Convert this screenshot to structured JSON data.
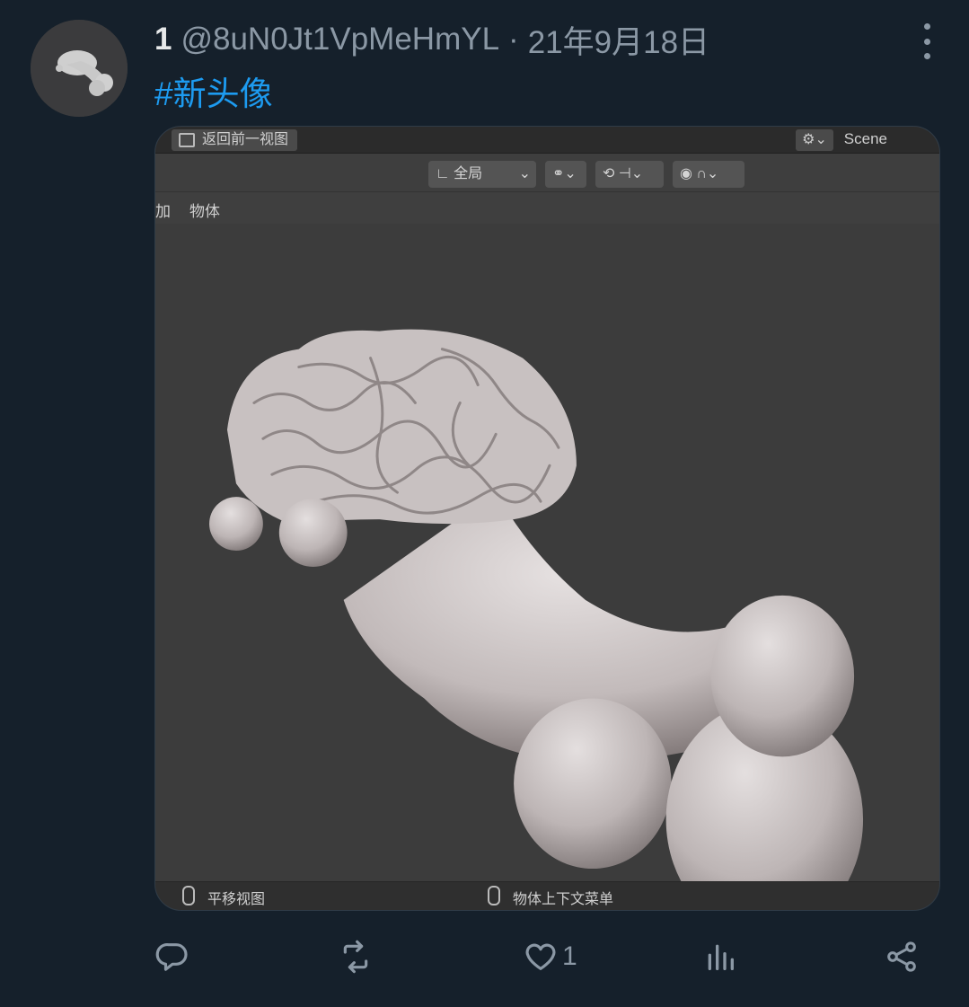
{
  "tweet": {
    "display_name": "1",
    "handle": "@8uN0Jt1VpMeHmYL",
    "separator": "·",
    "date": "21年9月18日",
    "hashtag": "#新头像",
    "more_icon": "more-vertical-icon",
    "link_color": "#1d9bf0"
  },
  "blender": {
    "back_label": "返回前一视图",
    "scene_label": "Scene",
    "transform_orientation": "全局",
    "menu_add": "加",
    "menu_object": "物体",
    "status_left": "平移视图",
    "status_right": "物体上下文菜单"
  },
  "actions": {
    "reply_icon": "reply-icon",
    "retweet_icon": "retweet-icon",
    "like_icon": "heart-icon",
    "like_count": "1",
    "analytics_icon": "analytics-icon",
    "share_icon": "share-icon"
  }
}
